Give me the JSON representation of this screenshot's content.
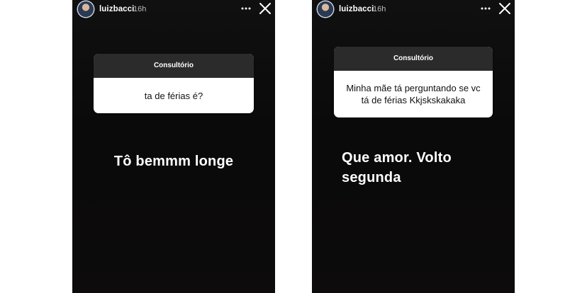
{
  "stories": [
    {
      "username": "luizbacci",
      "time": "16h",
      "question_title": "Consultório",
      "question_text": "ta de férias é?",
      "answer_text": "Tô bemmm longe"
    },
    {
      "username": "luizbacci",
      "time": "16h",
      "question_title": "Consultório",
      "question_text": "Minha mãe tá perguntando se vc tá de férias Kkjskskakaka",
      "answer_text": "Que amor. Volto segunda"
    }
  ],
  "colors": {
    "story_background": "#0d0d0d",
    "question_header": "#2b2b2b",
    "question_body": "#ffffff",
    "text_light": "#ffffff"
  },
  "icons": [
    "avatar",
    "more-icon",
    "close-icon"
  ]
}
